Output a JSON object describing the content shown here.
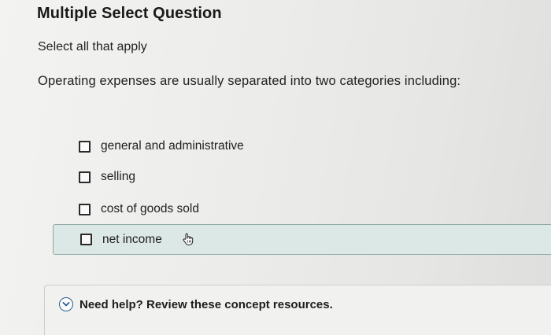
{
  "header": {
    "title": "Multiple Select Question"
  },
  "instruction": "Select all that apply",
  "question": "Operating expenses are usually separated into two categories including:",
  "options": [
    {
      "label": "general and administrative",
      "checked": false,
      "highlighted": false
    },
    {
      "label": "selling",
      "checked": false,
      "highlighted": false
    },
    {
      "label": "cost of goods sold",
      "checked": false,
      "highlighted": false
    },
    {
      "label": "net income",
      "checked": false,
      "highlighted": true
    }
  ],
  "help": {
    "label": "Need help? Review these concept resources.",
    "icon": "chevron-down-circle-icon"
  },
  "colors": {
    "highlight_bg": "#dce8e5",
    "highlight_border": "#8fa9a7",
    "help_icon": "#2a5d8f"
  }
}
